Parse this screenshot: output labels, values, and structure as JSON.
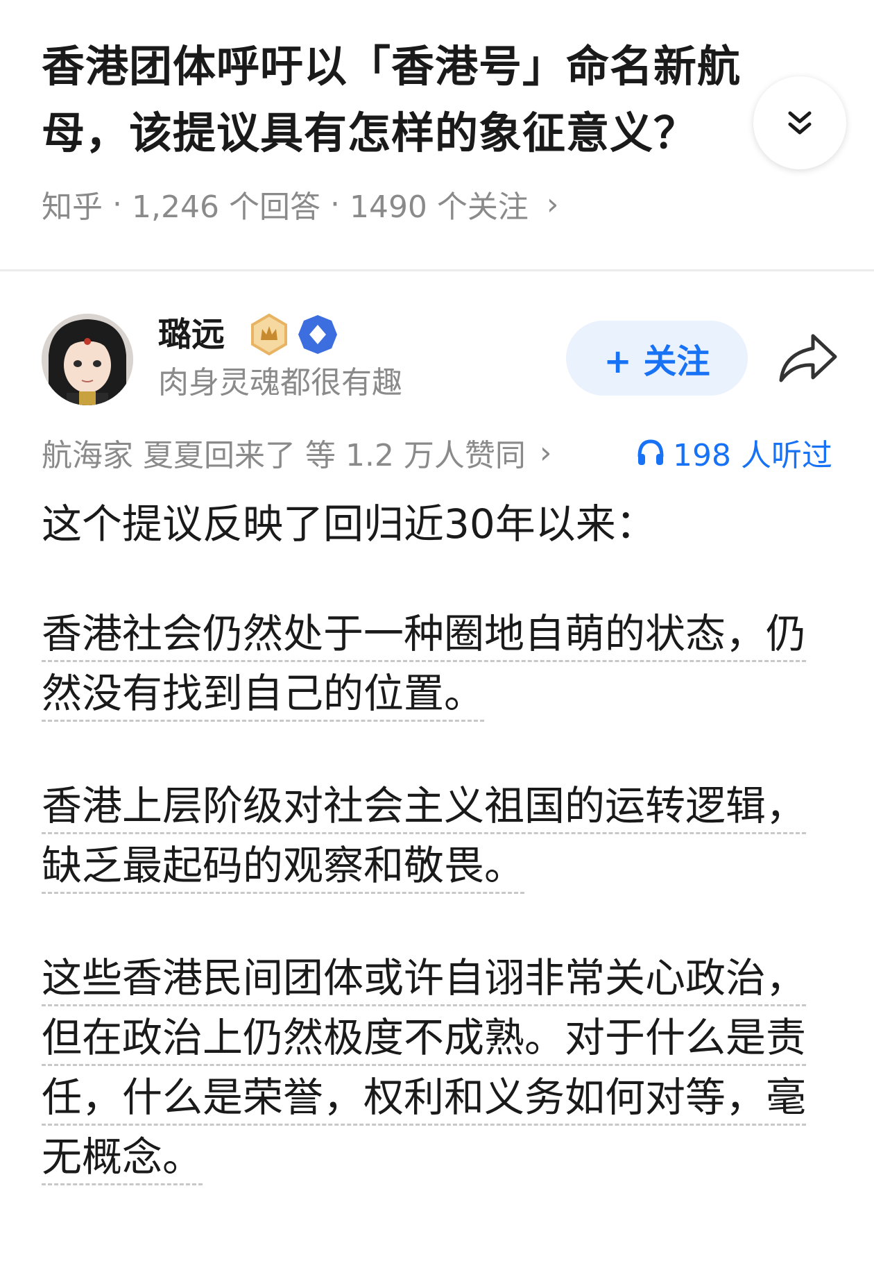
{
  "question": {
    "title": "香港团体呼吁以「香港号」命名新航母，该提议具有怎样的象征意义？",
    "source": "知乎",
    "answers": "1,246 个回答",
    "followers": "1490 个关注",
    "meta_chevron": "›",
    "separator": "·"
  },
  "author": {
    "name": "璐远",
    "signature": "肉身灵魂都很有趣",
    "follow_label": "+ 关注",
    "badge_colors": [
      "#e8b463",
      "#3d6ee0"
    ]
  },
  "engagement": {
    "voters_text": "航海家 夏夏回来了 等 1.2 万人赞同",
    "voters_chevron": "›",
    "listen_count": "198 人听过"
  },
  "answer": {
    "intro": "这个提议反映了回归近30年以来：",
    "paragraphs": [
      "香港社会仍然处于一种圈地自萌的状态，仍然没有找到自己的位置。",
      "香港上层阶级对社会主义祖国的运转逻辑，缺乏最起码的观察和敬畏。",
      "这些香港民间团体或许自诩非常关心政治，但在政治上仍然极度不成熟。对于什么是责任，什么是荣誉，权利和义务如何对等，毫无概念。"
    ]
  },
  "colors": {
    "accent": "#1772f6",
    "muted": "#8a8a8a",
    "text": "#1a1a1a"
  }
}
